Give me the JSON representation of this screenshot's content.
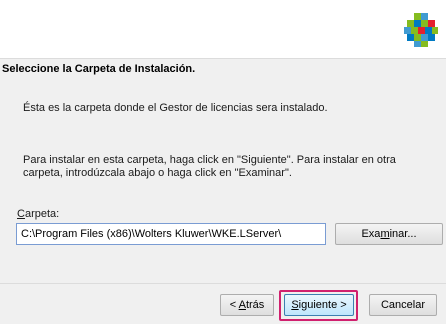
{
  "header": {
    "logo": "wolters-kluwer-logo",
    "logo_colors": [
      "#85bc20",
      "#007ac3",
      "#e5202e",
      "#409bd2",
      "#ffffff"
    ]
  },
  "section_title": "Seleccione la Carpeta de Instalación.",
  "description": "Ésta es la carpeta donde el Gestor de licencias sera instalado.",
  "instructions": "Para instalar en esta carpeta, haga click en \"Siguiente\". Para instalar en otra carpeta, introdúzcala abajo o haga click en \"Examinar\".",
  "folder": {
    "label_accel": "C",
    "label_rest": "arpeta:",
    "path_value": "C:\\Program Files (x86)\\Wolters Kluwer\\WKE.LServer\\"
  },
  "buttons": {
    "browse_pre": "Exa",
    "browse_accel": "m",
    "browse_post": "inar...",
    "back_pre": "< ",
    "back_accel": "A",
    "back_post": "trás",
    "next_accel": "S",
    "next_post": "iguiente >",
    "cancel": "Cancelar"
  },
  "accent_color": "#d0206e"
}
